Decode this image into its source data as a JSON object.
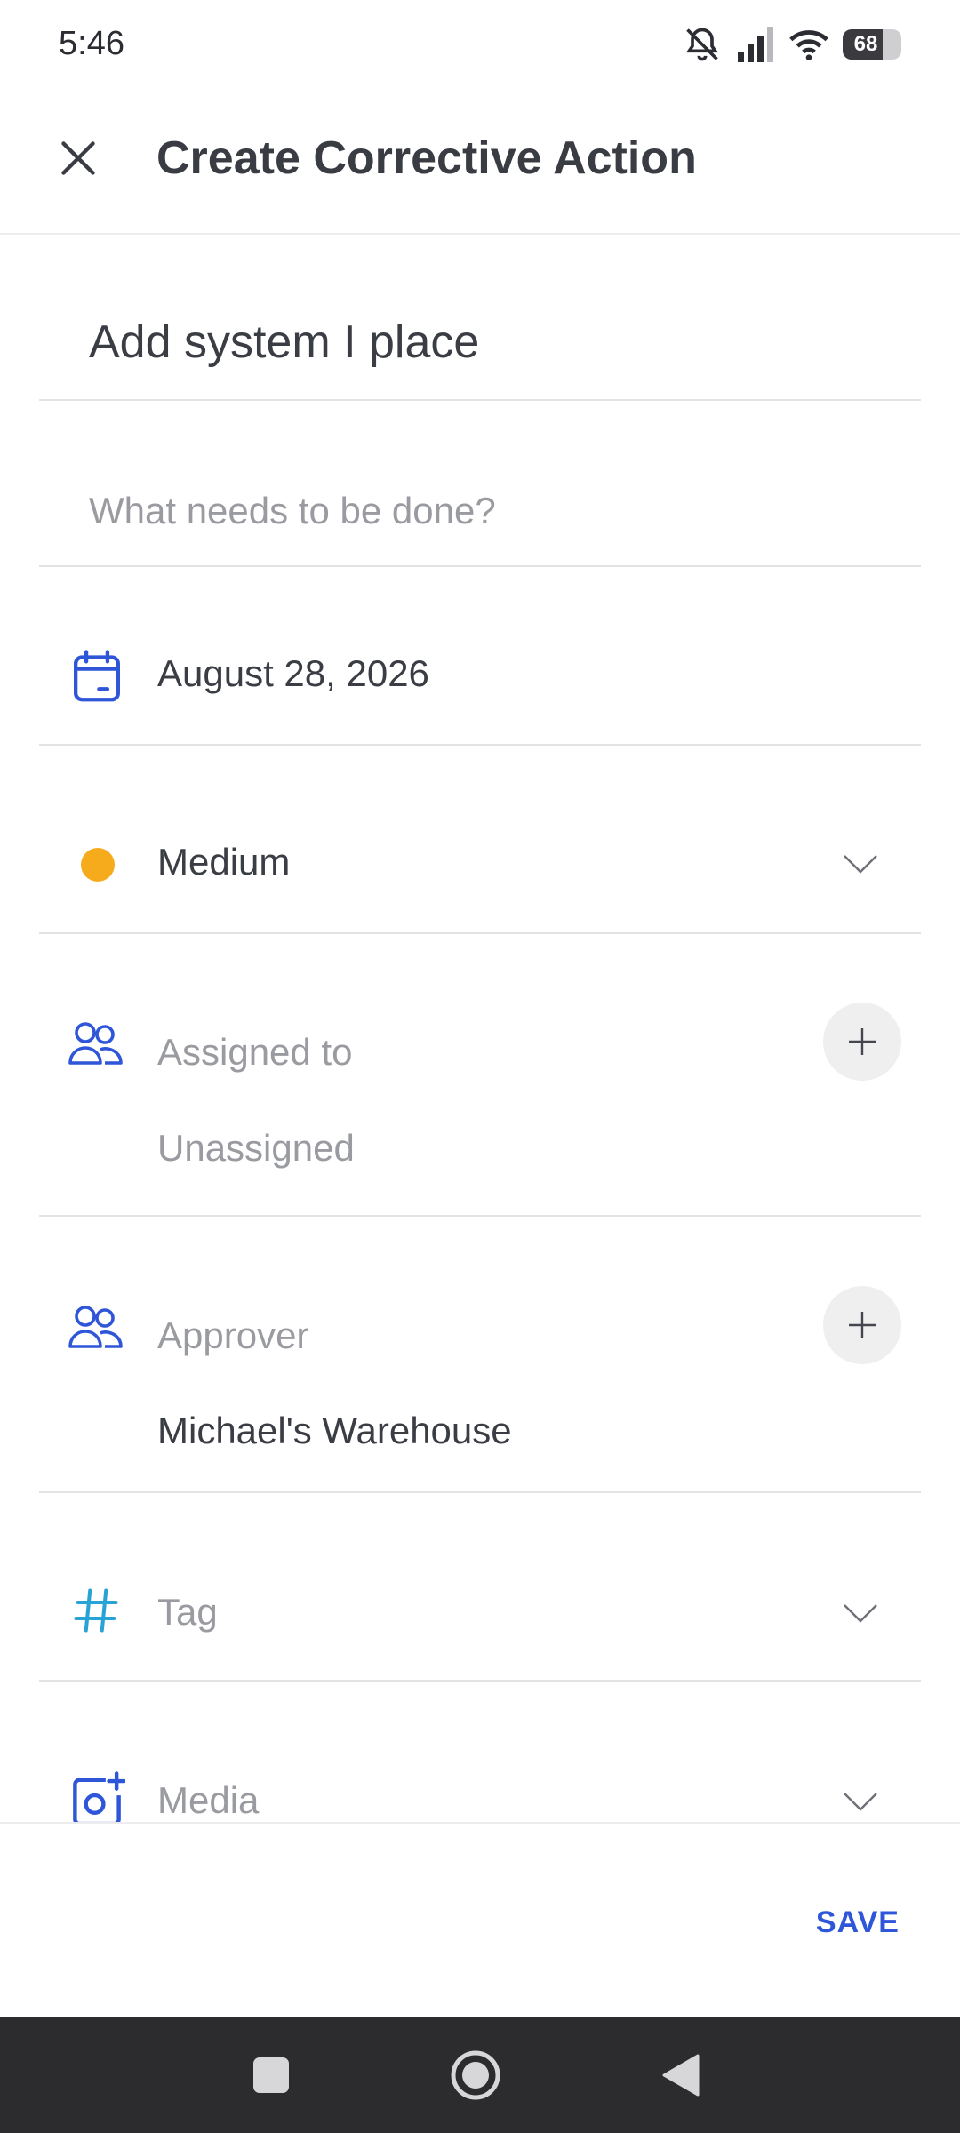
{
  "status_bar": {
    "time": "5:46",
    "battery": "68"
  },
  "header": {
    "title": "Create Corrective Action"
  },
  "form": {
    "title_value": "Add system I place",
    "description_placeholder": "What needs to be done?",
    "due_date": "August 28, 2026",
    "priority": {
      "label": "Medium",
      "color": "#f5ab1b"
    },
    "assigned_to": {
      "label": "Assigned to",
      "value": "Unassigned"
    },
    "approver": {
      "label": "Approver",
      "value": "Michael's Warehouse"
    },
    "tag": {
      "label": "Tag"
    },
    "media": {
      "label": "Media"
    }
  },
  "actions": {
    "save_label": "SAVE"
  },
  "colors": {
    "accent": "#2f56d8",
    "tag_icon": "#29a3d6"
  }
}
